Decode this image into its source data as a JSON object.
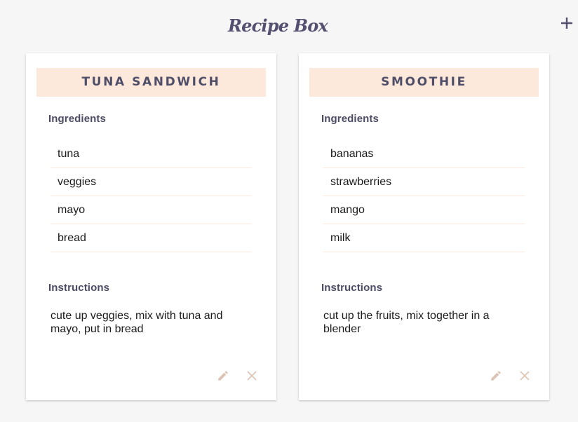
{
  "app": {
    "title": "Recipe Box",
    "add_icon": "plus-icon"
  },
  "colors": {
    "background": "#f6f6f6",
    "card": "#ffffff",
    "header_band": "#fde9dc",
    "title_text": "#545071",
    "action_icons": "#dcc4b5"
  },
  "recipes": [
    {
      "name": "TUNA SANDWICH",
      "ingredients_label": "Ingredients",
      "ingredients": [
        "tuna",
        "veggies",
        "mayo",
        "bread"
      ],
      "instructions_label": "Instructions",
      "instructions": "cute up veggies, mix with tuna and mayo, put in bread",
      "edit_icon": "pencil-icon",
      "delete_icon": "close-icon"
    },
    {
      "name": "SMOOTHIE",
      "ingredients_label": "Ingredients",
      "ingredients": [
        "bananas",
        "strawberries",
        "mango",
        "milk"
      ],
      "instructions_label": "Instructions",
      "instructions": "cut up the fruits, mix together in a blender",
      "edit_icon": "pencil-icon",
      "delete_icon": "close-icon"
    }
  ]
}
